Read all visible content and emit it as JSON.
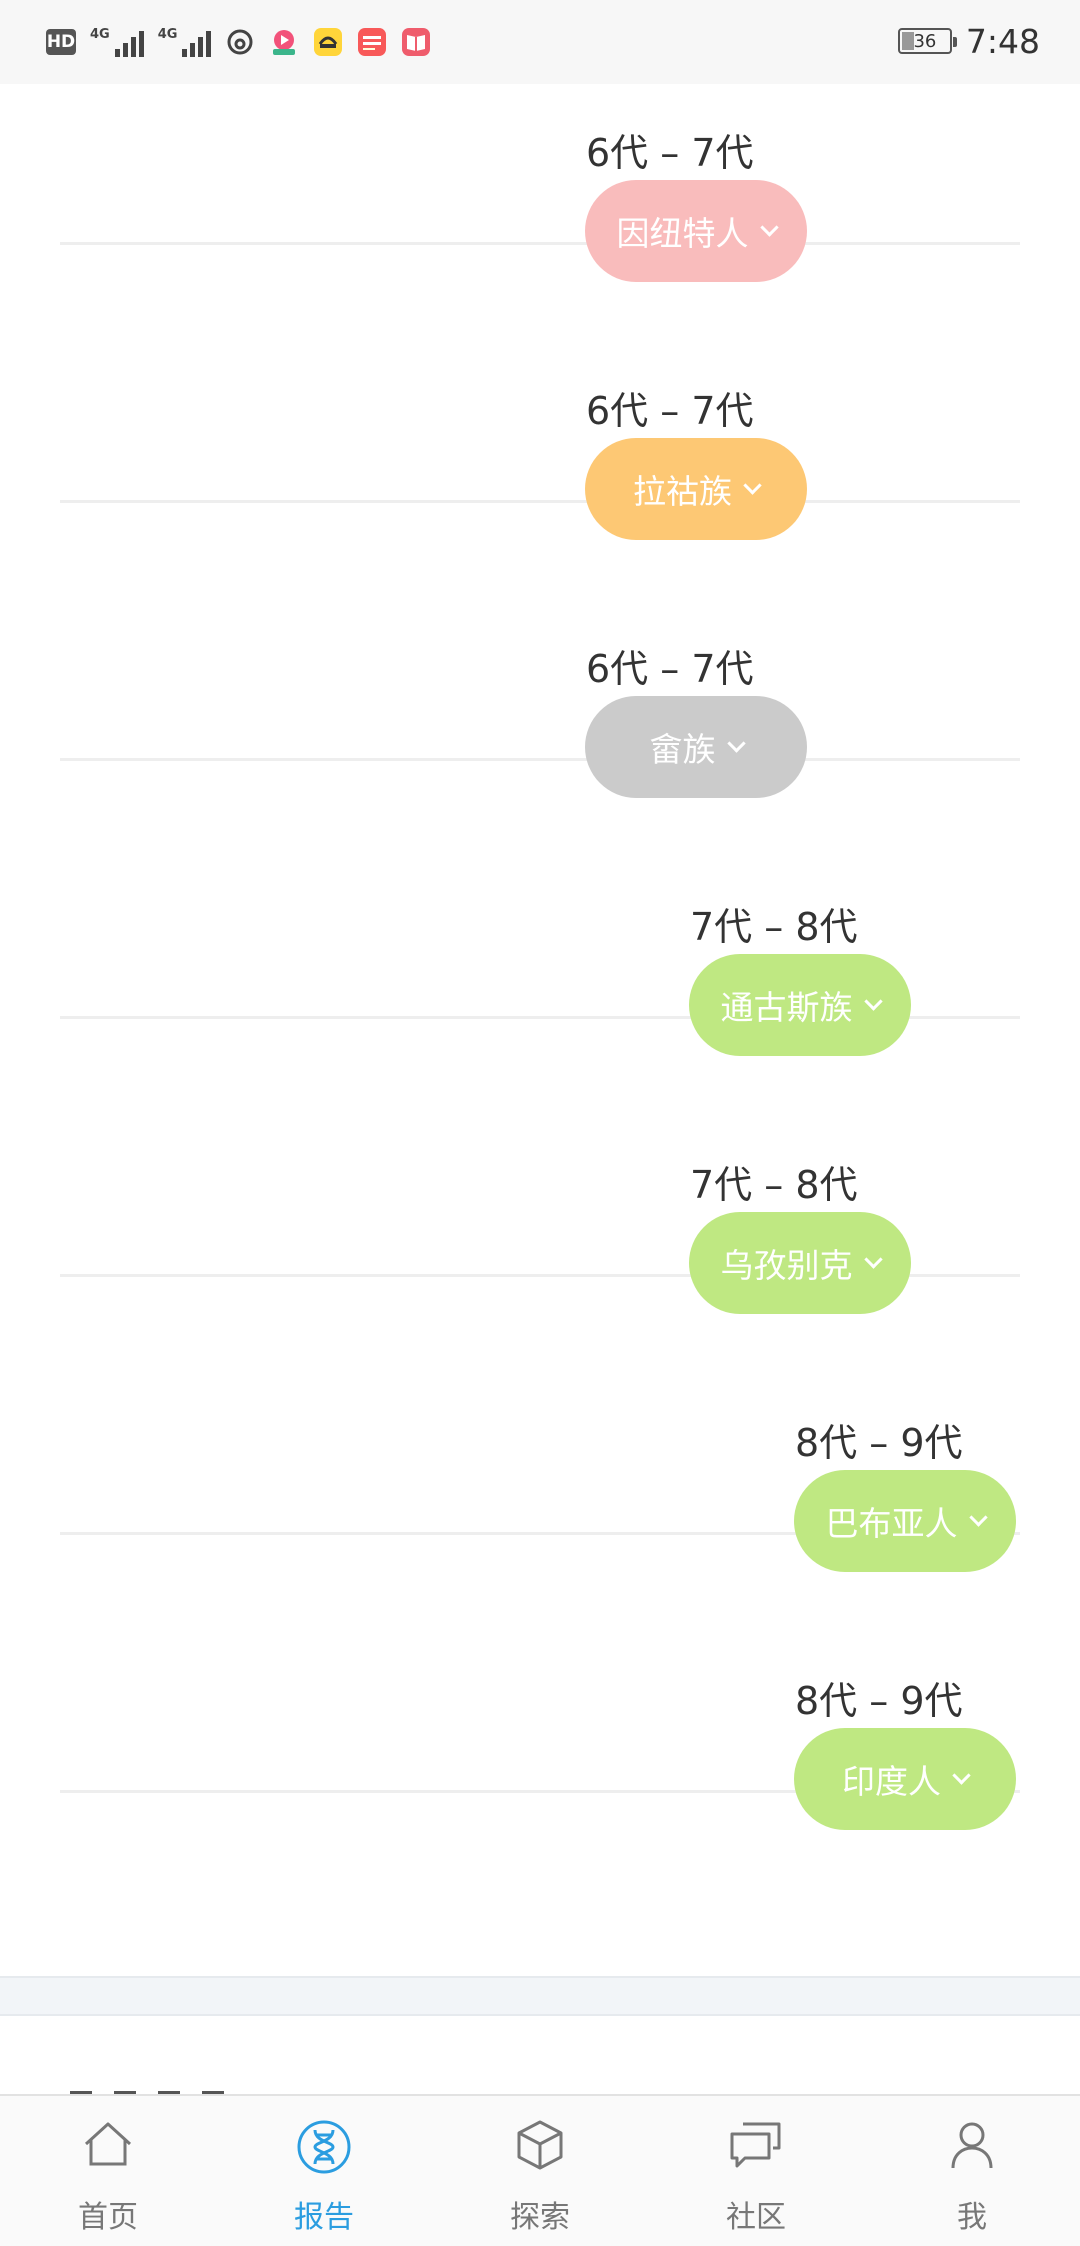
{
  "status_bar": {
    "hd": "HD",
    "network_1": "4G",
    "network_2": "4G",
    "battery": "36",
    "time": "7:48"
  },
  "timeline": [
    {
      "generations": "6代 – 7代",
      "label": "因纽特人",
      "color": "#f9bcbc"
    },
    {
      "generations": "6代 – 7代",
      "label": "拉祜族",
      "color": "#fdc874"
    },
    {
      "generations": "6代 – 7代",
      "label": "畲族",
      "color": "#cbcbcb"
    },
    {
      "generations": "7代 – 8代",
      "label": "通古斯族",
      "color": "#bfe882"
    },
    {
      "generations": "7代 – 8代",
      "label": "乌孜别克",
      "color": "#bfe882"
    },
    {
      "generations": "8代 – 9代",
      "label": "巴布亚人",
      "color": "#bfe882"
    },
    {
      "generations": "8代 – 9代",
      "label": "印度人",
      "color": "#bfe882"
    }
  ],
  "bottom_nav": {
    "active_color": "#2b9de0",
    "items": [
      {
        "label": "首页",
        "icon": "home-icon"
      },
      {
        "label": "报告",
        "icon": "dna-icon"
      },
      {
        "label": "探索",
        "icon": "cube-icon"
      },
      {
        "label": "社区",
        "icon": "chat-icon"
      },
      {
        "label": "我",
        "icon": "user-icon"
      }
    ]
  }
}
